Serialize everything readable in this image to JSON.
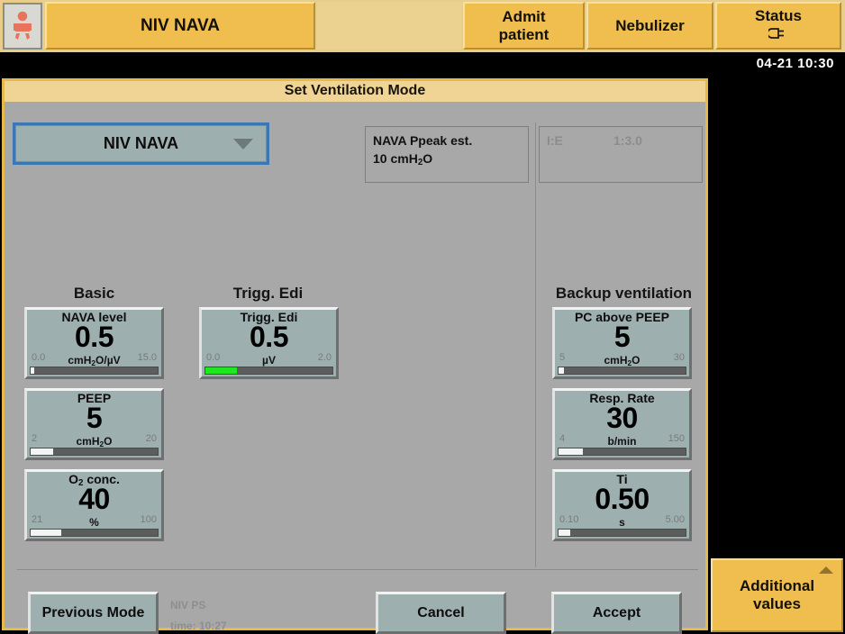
{
  "topbar": {
    "patient_icon": "infant-patient-icon",
    "mode_tab": "NIV NAVA",
    "admit_tab": "Admit\npatient",
    "admit_line1": "Admit",
    "admit_line2": "patient",
    "nebulizer_tab": "Nebulizer",
    "status_tab": "Status",
    "status_icon": "power-plug-icon",
    "datetime": "04-21   10:30"
  },
  "dialog": {
    "title": "Set Ventilation Mode",
    "mode_select": {
      "value": "NIV NAVA",
      "caret_icon": "chevron-down-icon"
    },
    "info_boxes": [
      {
        "name": "nava-ppeak-est",
        "line1": "NAVA Ppeak est.",
        "line2_value": "10",
        "line2_unit": "cmH2O",
        "disabled": false
      },
      {
        "name": "ie-ratio",
        "label": "I:E",
        "value": "1:3.0",
        "disabled": true
      }
    ],
    "sections": {
      "basic": "Basic",
      "trigg_edi": "Trigg. Edi",
      "backup": "Backup ventilation"
    },
    "parameters": [
      {
        "id": "nava-level",
        "name": "NAVA level",
        "value": "0.5",
        "unit": "cmH2O/µV",
        "unit_html": "cmH<sub>2</sub>O/µV",
        "min": "0.0",
        "max": "15.0",
        "fill_pct": 3,
        "fill_color": "#f4f4f4"
      },
      {
        "id": "peep",
        "name": "PEEP",
        "value": "5",
        "unit": "cmH2O",
        "unit_html": "cmH<sub>2</sub>O",
        "min": "2",
        "max": "20",
        "fill_pct": 18,
        "fill_color": "#f4f4f4"
      },
      {
        "id": "o2-conc",
        "name": "O2 conc.",
        "name_html": "O<sub>2</sub> conc.",
        "value": "40",
        "unit": "%",
        "unit_html": "%",
        "min": "21",
        "max": "100",
        "fill_pct": 24,
        "fill_color": "#f4f4f4"
      },
      {
        "id": "trigg-edi",
        "name": "Trigg. Edi",
        "value": "0.5",
        "unit": "µV",
        "unit_html": "µV",
        "min": "0.0",
        "max": "2.0",
        "fill_pct": 25,
        "fill_color": "#1fe61f"
      },
      {
        "id": "pc-above-peep",
        "name": "PC above PEEP",
        "value": "5",
        "unit": "cmH2O",
        "unit_html": "cmH<sub>2</sub>O",
        "min": "5",
        "max": "30",
        "fill_pct": 4,
        "fill_color": "#f4f4f4"
      },
      {
        "id": "resp-rate",
        "name": "Resp. Rate",
        "value": "30",
        "unit": "b/min",
        "unit_html": "b/min",
        "min": "4",
        "max": "150",
        "fill_pct": 19,
        "fill_color": "#f4f4f4"
      },
      {
        "id": "ti",
        "name": "Ti",
        "value": "0.50",
        "unit": "s",
        "unit_html": "s",
        "min": "0.10",
        "max": "5.00",
        "fill_pct": 9,
        "fill_color": "#f4f4f4"
      }
    ],
    "buttons": {
      "previous_mode": "Previous Mode",
      "cancel": "Cancel",
      "accept": "Accept"
    },
    "previous_mode_info": {
      "mode": "NIV PS",
      "time": "time: 10:27"
    }
  },
  "additional_values": {
    "line1": "Additional",
    "line2": "values",
    "caret_icon": "chevron-up-icon"
  },
  "colors": {
    "tab_gold": "#efbe4f",
    "topbar_bg": "#e8cd8b",
    "dialog_border": "#e5b94a",
    "dialog_title_bg": "#efd495",
    "dialog_bg": "#a8a8a8",
    "param_bg": "#9eafaf",
    "focus_blue": "#3a78b5",
    "bar_track": "#5d5d5d",
    "bar_thumb": "#f4f4f4",
    "bar_green": "#1fe61f",
    "dim_text": "#8c8c8c"
  }
}
